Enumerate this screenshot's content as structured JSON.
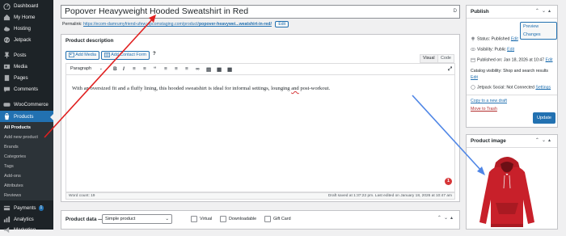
{
  "sidebar": {
    "items": [
      {
        "label": "Dashboard",
        "icon": "dashboard-icon"
      },
      {
        "label": "My Home",
        "icon": "home-icon"
      },
      {
        "label": "Hosting",
        "icon": "cloud-icon"
      },
      {
        "label": "Jetpack",
        "icon": "jetpack-icon"
      },
      {
        "label": "Posts",
        "icon": "pin-icon"
      },
      {
        "label": "Media",
        "icon": "media-icon"
      },
      {
        "label": "Pages",
        "icon": "pages-icon"
      },
      {
        "label": "Comments",
        "icon": "comment-icon"
      },
      {
        "label": "WooCommerce",
        "icon": "woo-icon"
      },
      {
        "label": "Products",
        "icon": "products-icon"
      },
      {
        "label": "Payments",
        "icon": "payments-icon",
        "badge": "1"
      },
      {
        "label": "Analytics",
        "icon": "analytics-icon"
      },
      {
        "label": "Marketing",
        "icon": "marketing-icon"
      }
    ],
    "submenu": [
      "All Products",
      "Add new product",
      "Brands",
      "Categories",
      "Tags",
      "Add-ons",
      "Attributes",
      "Reviews"
    ]
  },
  "title": {
    "value": "Popover Heavyweight Hooded Sweatshirt in Red",
    "info_glyph": "D"
  },
  "permalink": {
    "label": "Permalink:",
    "url_start": "https://ecom-damrumyfriend-",
    "url_mid": "ufew.wpcomstaging.com/product/",
    "url_slug": "popover-heavywei...weatshirt-in-red/",
    "edit": "Edit"
  },
  "description": {
    "title": "Product description",
    "add_media": "Add Media",
    "add_contact_form": "Add Contact Form",
    "help_glyph": "?",
    "tab_visual": "Visual",
    "tab_code": "Code",
    "format_select": "Paragraph",
    "text_before": "With an oversized fit and a fluffy lining, this hooded sweatshirt is ideal for informal settings, lounging ",
    "text_and": "and",
    "text_after": " post-workout.",
    "word_count": "Word count: 19",
    "draft_saved": "Draft saved at 1:37:22 pm. Last edited on January 18, 2026 at 10:47 am",
    "notification_count": "1"
  },
  "product_data": {
    "label": "Product data —",
    "type": "Simple product",
    "virtual": "Virtual",
    "downloadable": "Downloadable",
    "gift_card": "Gift Card"
  },
  "publish": {
    "title": "Publish",
    "preview": "Preview Changes",
    "status": "Status: Published",
    "visibility": "Visibility: Public",
    "published_on": "Published on: Jan 18, 2026 at 10:47",
    "catalog": "Catalog visibility: Shop and search results",
    "jetpack": "Jetpack Social: Not Connected",
    "settings": "Settings",
    "edit": "Edit",
    "copy_draft": "Copy to a new draft",
    "trash": "Move to Trash",
    "update": "Update"
  },
  "product_image": {
    "title": "Product image"
  },
  "colors": {
    "accent": "#2271b1",
    "sidebar": "#1d2327",
    "annotation_red": "#e02020",
    "annotation_blue": "#4f86e6",
    "hoodie": "#c8202a"
  }
}
